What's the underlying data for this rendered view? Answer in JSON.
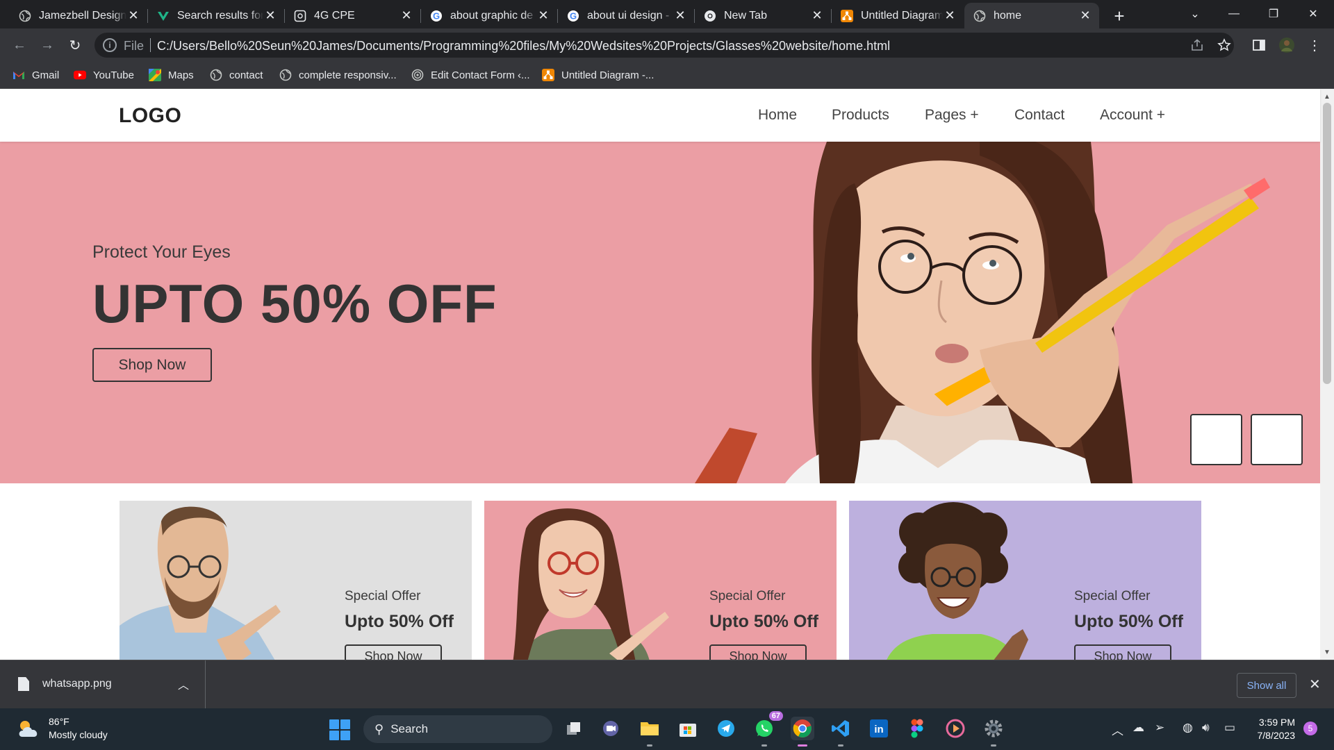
{
  "browser": {
    "tabs": [
      {
        "title": "Jamezbell Design",
        "icon": "globe-icon"
      },
      {
        "title": "Search results for",
        "icon": "vectorgrove-icon"
      },
      {
        "title": "4G CPE",
        "icon": "router-icon"
      },
      {
        "title": "about graphic de",
        "icon": "google-icon"
      },
      {
        "title": "about ui design -",
        "icon": "google-icon"
      },
      {
        "title": "New Tab",
        "icon": "chrome-icon"
      },
      {
        "title": "Untitled Diagram",
        "icon": "drawio-icon"
      },
      {
        "title": "home",
        "icon": "globe-icon",
        "active": true
      }
    ],
    "new_tab_symbol": "+",
    "address": {
      "scheme_label": "File",
      "url": "C:/Users/Bello%20Seun%20James/Documents/Programming%20files/My%20Wedsites%20Projects/Glasses%20website/home.html"
    },
    "bookmarks": [
      {
        "label": "Gmail",
        "icon": "gmail-icon"
      },
      {
        "label": "YouTube",
        "icon": "youtube-icon"
      },
      {
        "label": "Maps",
        "icon": "maps-icon"
      },
      {
        "label": "contact",
        "icon": "globe-icon"
      },
      {
        "label": "complete responsiv...",
        "icon": "globe-icon"
      },
      {
        "label": "Edit Contact Form ‹...",
        "icon": "wordpress-icon"
      },
      {
        "label": "Untitled Diagram -...",
        "icon": "drawio-icon"
      }
    ]
  },
  "page": {
    "logo": "LOGO",
    "nav": [
      "Home",
      "Products",
      "Pages +",
      "Contact",
      "Account +"
    ],
    "hero": {
      "subtitle": "Protect Your Eyes",
      "title": "UPTO 50% OFF",
      "button": "Shop Now",
      "background": "#eb9ea4"
    },
    "cards": [
      {
        "subtitle": "Special Offer",
        "title": "Upto 50% Off",
        "button": "Shop Now",
        "background": "#e0e0e0"
      },
      {
        "subtitle": "Special Offer",
        "title": "Upto 50% Off",
        "button": "Shop Now",
        "background": "#eb9ea4"
      },
      {
        "subtitle": "Special Offer",
        "title": "Upto 50% Off",
        "button": "Shop Now",
        "background": "#bdb0de"
      }
    ]
  },
  "downloads": {
    "file": "whatsapp.png",
    "show_all": "Show all"
  },
  "taskbar": {
    "weather_temp": "86°F",
    "weather_desc": "Mostly cloudy",
    "search": "Search",
    "whatsapp_badge": "67",
    "time": "3:59 PM",
    "date": "7/8/2023",
    "notifications": "5"
  }
}
